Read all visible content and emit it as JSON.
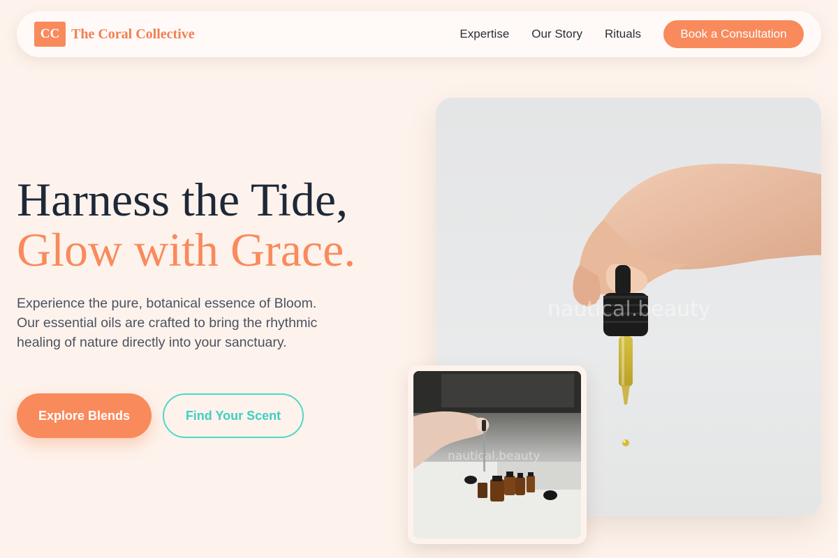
{
  "brand": {
    "mark": "CC",
    "name": "The Coral Collective"
  },
  "nav": {
    "links": [
      "Expertise",
      "Our Story",
      "Rituals"
    ],
    "cta": "Book a Consultation"
  },
  "hero": {
    "headline_line1": "Harness the Tide,",
    "headline_line2": "Glow with Grace.",
    "lede": "Experience the pure, botanical essence of Bloom. Our essential oils are crafted to bring the rhythmic healing of nature directly into your sanctuary.",
    "primary_cta": "Explore Blends",
    "secondary_cta": "Find Your Scent"
  },
  "images": {
    "main_watermark": "nautical.beauty",
    "inset_watermark": "nautical.beauty"
  },
  "colors": {
    "accent": "#f98a5c",
    "teal": "#4fd6c8",
    "background": "#fdf3ec",
    "heading": "#1e2838"
  }
}
